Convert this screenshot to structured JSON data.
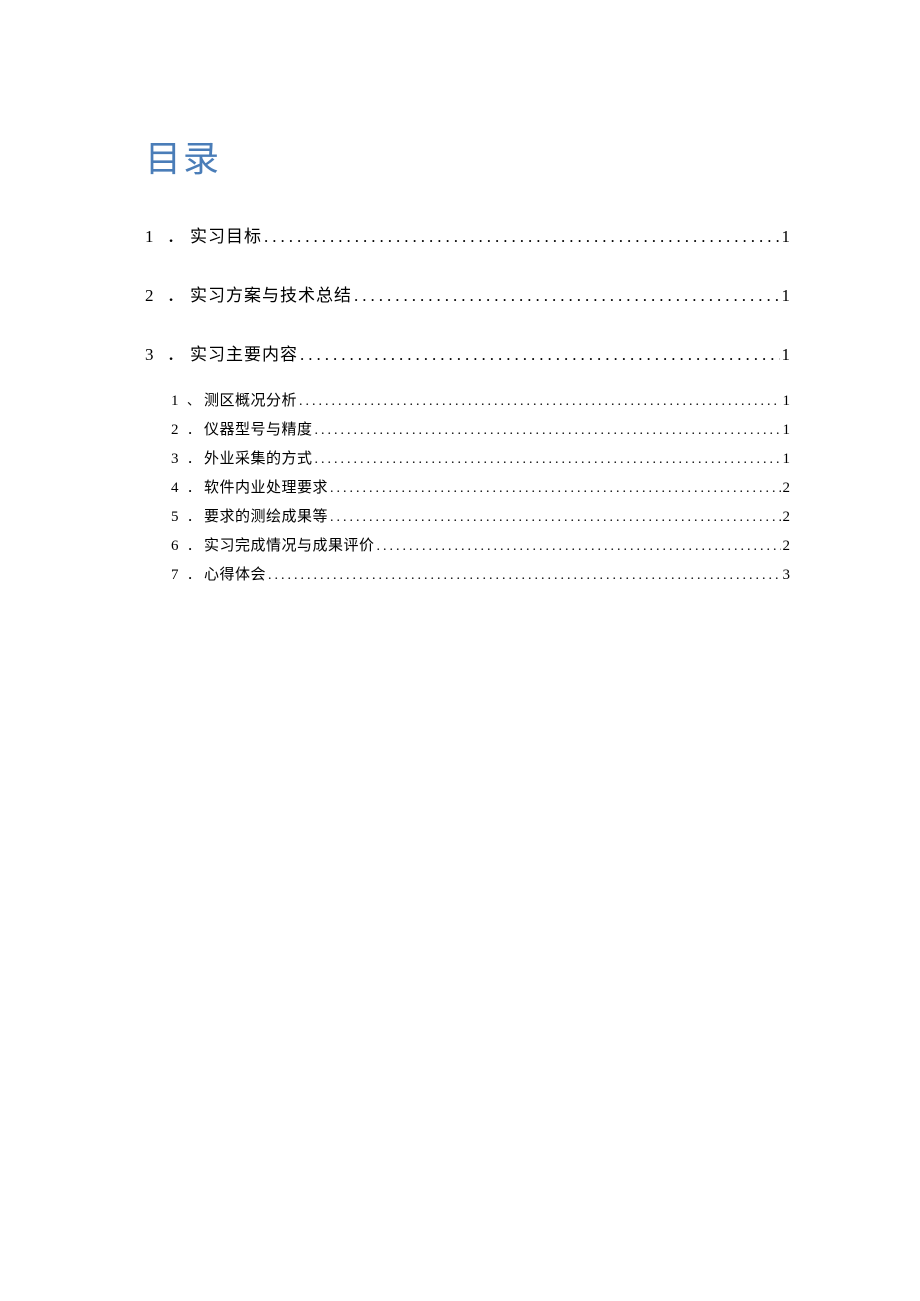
{
  "toc": {
    "heading": "目录",
    "level1": [
      {
        "num": "1",
        "sep": "．",
        "title": "实习目标",
        "page": "1"
      },
      {
        "num": "2",
        "sep": "．",
        "title": "实习方案与技术总结",
        "page": "1"
      },
      {
        "num": "3",
        "sep": "．",
        "title": "实习主要内容",
        "page": "1"
      }
    ],
    "level2": [
      {
        "num": "1",
        "sep": "、",
        "title": "测区概况分析",
        "page": "1"
      },
      {
        "num": "2",
        "sep": "．",
        "title": "仪器型号与精度",
        "page": "1"
      },
      {
        "num": "3",
        "sep": "．",
        "title": "外业采集的方式",
        "page": "1"
      },
      {
        "num": "4",
        "sep": "．",
        "title": "软件内业处理要求",
        "page": "2"
      },
      {
        "num": "5",
        "sep": "．",
        "title": "要求的测绘成果等",
        "page": "2"
      },
      {
        "num": "6",
        "sep": "．",
        "title": "实习完成情况与成果评价",
        "page": "2"
      },
      {
        "num": "7",
        "sep": "．",
        "title": "心得体会",
        "page": "3"
      }
    ],
    "dots": "................................................................................................................"
  }
}
